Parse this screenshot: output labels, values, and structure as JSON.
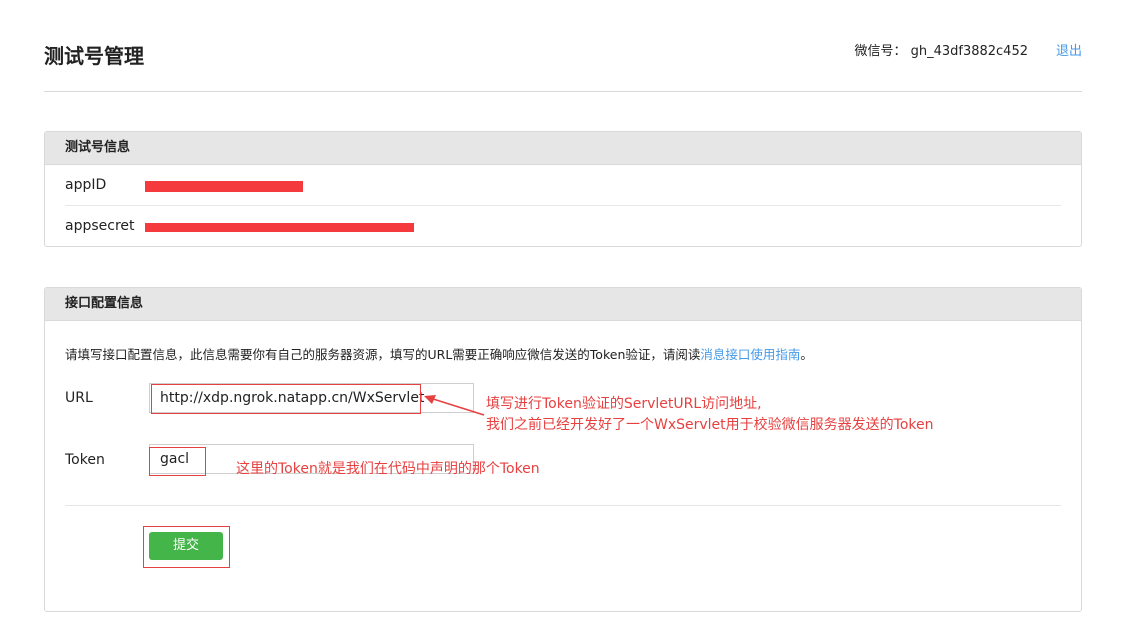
{
  "header": {
    "title": "测试号管理",
    "account_text": "微信号： gh_43df3882c452",
    "logout_label": "退出"
  },
  "test_account_panel": {
    "title": "测试号信息",
    "rows": [
      {
        "label": "appID"
      },
      {
        "label": "appsecret"
      }
    ]
  },
  "interface_panel": {
    "title": "接口配置信息",
    "description": "请填写接口配置信息，此信息需要你有自己的服务器资源，填写的URL需要正确响应微信发送的Token验证，请阅读",
    "description_link": "消息接口使用指南",
    "description_end": "。",
    "url_label": "URL",
    "url_value": "http://xdp.ngrok.natapp.cn/WxServlet",
    "token_label": "Token",
    "token_value": "gacl",
    "submit_label": "提交"
  },
  "annotations": {
    "url_note_line1": "填写进行Token验证的ServletURL访问地址,",
    "url_note_line2": "我们之前已经开发好了一个WxServlet用于校验微信服务器发送的Token",
    "token_note": "这里的Token就是我们在代码中声明的那个Token",
    "color": "#e74040"
  },
  "colors": {
    "link": "#459ae9",
    "submit": "#44b549",
    "redaction": "#f43a3d"
  }
}
